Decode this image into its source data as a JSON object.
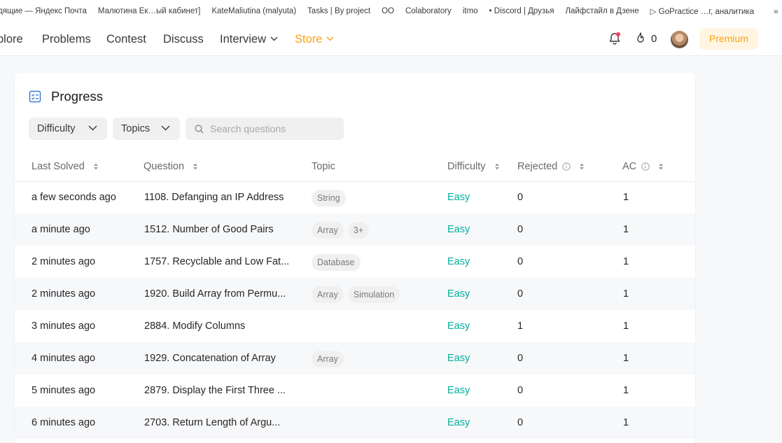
{
  "bookmarks": [
    "дящие — Яндекс Почта",
    "Малютина Ек…ый кабинет]",
    "KateMaliutina (malyuta)",
    "Tasks | By project",
    "OO",
    "Colaboratory",
    "itmo",
    "• Discord | Друзья",
    "Лайфстайл в Дзене",
    "▷ GoPractice …г, аналитика"
  ],
  "bookmarks_more": "»",
  "nav": {
    "items": [
      "plore",
      "Problems",
      "Contest",
      "Discuss",
      "Interview",
      "Store"
    ],
    "streak": "0",
    "premium": "Premium"
  },
  "progress": {
    "title": "Progress",
    "filters": [
      "Difficulty",
      "Topics"
    ],
    "search_placeholder": "Search questions",
    "columns": [
      "Last Solved",
      "Question",
      "Topic",
      "Difficulty",
      "Rejected",
      "AC"
    ],
    "rows": [
      {
        "last_solved": "a few seconds ago",
        "question": "1108. Defanging an IP Address",
        "topics": [
          "String"
        ],
        "difficulty": "Easy",
        "rejected": "0",
        "ac": "1"
      },
      {
        "last_solved": "a minute ago",
        "question": "1512. Number of Good Pairs",
        "topics": [
          "Array",
          "3+"
        ],
        "difficulty": "Easy",
        "rejected": "0",
        "ac": "1"
      },
      {
        "last_solved": "2 minutes ago",
        "question": "1757. Recyclable and Low Fat...",
        "topics": [
          "Database"
        ],
        "difficulty": "Easy",
        "rejected": "0",
        "ac": "1"
      },
      {
        "last_solved": "2 minutes ago",
        "question": "1920. Build Array from Permu...",
        "topics": [
          "Array",
          "Simulation"
        ],
        "difficulty": "Easy",
        "rejected": "0",
        "ac": "1"
      },
      {
        "last_solved": "3 minutes ago",
        "question": "2884. Modify Columns",
        "topics": [],
        "difficulty": "Easy",
        "rejected": "1",
        "ac": "1"
      },
      {
        "last_solved": "4 minutes ago",
        "question": "1929. Concatenation of Array",
        "topics": [
          "Array"
        ],
        "difficulty": "Easy",
        "rejected": "0",
        "ac": "1"
      },
      {
        "last_solved": "5 minutes ago",
        "question": "2879. Display the First Three ...",
        "topics": [],
        "difficulty": "Easy",
        "rejected": "0",
        "ac": "1"
      },
      {
        "last_solved": "6 minutes ago",
        "question": "2703. Return Length of Argu...",
        "topics": [],
        "difficulty": "Easy",
        "rejected": "0",
        "ac": "1"
      }
    ]
  },
  "icons": {
    "notification": "bell-icon",
    "streak": "flame-icon",
    "progress": "checklist-icon",
    "search": "search-icon",
    "sort": "sort-icon",
    "info": "info-icon",
    "dropdown": "chevron-down-icon"
  },
  "colors": {
    "accent": "#ffa116",
    "easy": "#00af9b",
    "premium_bg": "#fff5e1",
    "notification_dot": "#ff375f"
  }
}
